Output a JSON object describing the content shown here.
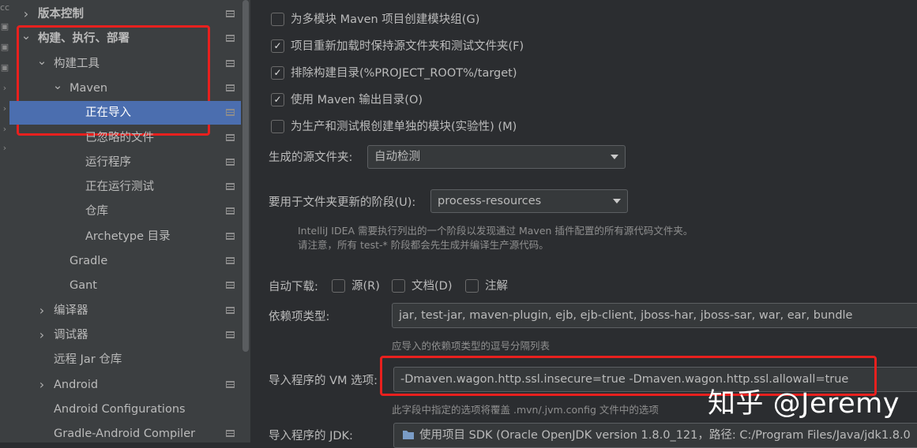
{
  "left_edge": [
    "cc",
    "",
    "",
    "",
    "",
    "",
    "",
    "",
    "",
    "",
    "",
    "",
    "",
    "",
    "",
    "",
    "",
    ""
  ],
  "sidebar": {
    "items": [
      {
        "label": "版本控制",
        "indent": 0,
        "chevron": "right",
        "bold": true
      },
      {
        "label": "构建、执行、部署",
        "indent": 0,
        "chevron": "down",
        "bold": true
      },
      {
        "label": "构建工具",
        "indent": 1,
        "chevron": "down"
      },
      {
        "label": "Maven",
        "indent": 2,
        "chevron": "down"
      },
      {
        "label": "正在导入",
        "indent": 3,
        "chevron": "",
        "selected": true
      },
      {
        "label": "已忽略的文件",
        "indent": 3,
        "chevron": ""
      },
      {
        "label": "运行程序",
        "indent": 3,
        "chevron": ""
      },
      {
        "label": "正在运行测试",
        "indent": 3,
        "chevron": ""
      },
      {
        "label": "仓库",
        "indent": 3,
        "chevron": ""
      },
      {
        "label": "Archetype 目录",
        "indent": 3,
        "chevron": ""
      },
      {
        "label": "Gradle",
        "indent": 2,
        "chevron": ""
      },
      {
        "label": "Gant",
        "indent": 2,
        "chevron": ""
      },
      {
        "label": "编译器",
        "indent": 1,
        "chevron": "right"
      },
      {
        "label": "调试器",
        "indent": 1,
        "chevron": "right"
      },
      {
        "label": "远程 Jar 仓库",
        "indent": 1,
        "chevron": ""
      },
      {
        "label": "Android",
        "indent": 1,
        "chevron": "right"
      },
      {
        "label": "Android Configurations",
        "indent": 1,
        "chevron": ""
      },
      {
        "label": "Gradle-Android Compiler",
        "indent": 1,
        "chevron": ""
      }
    ]
  },
  "main": {
    "checkboxes": [
      {
        "label": "为多模块 Maven 项目创建模块组(G)",
        "checked": false
      },
      {
        "label": "项目重新加载时保持源文件夹和测试文件夹(F)",
        "checked": true
      },
      {
        "label": "排除构建目录(%PROJECT_ROOT%/target)",
        "checked": true
      },
      {
        "label": "使用 Maven 输出目录(O)",
        "checked": true
      },
      {
        "label": "为生产和测试根创建单独的模块(实验性) (M)",
        "checked": false
      }
    ],
    "generated_sources": {
      "label": "生成的源文件夹:",
      "value": "自动检测"
    },
    "phase": {
      "label": "要用于文件夹更新的阶段(U):",
      "value": "process-resources",
      "hint_line1": "IntelliJ IDEA 需要执行列出的一个阶段以发现通过 Maven 插件配置的所有源代码文件夹。",
      "hint_line2": "请注意，所有 test-* 阶段都会先生成并编译生产源代码。"
    },
    "auto_download": {
      "label": "自动下载:",
      "options": [
        {
          "label": "源(R)",
          "checked": false
        },
        {
          "label": "文档(D)",
          "checked": false
        },
        {
          "label": "注解",
          "checked": false
        }
      ]
    },
    "dependency_types": {
      "label": "依赖项类型:",
      "value": "jar, test-jar, maven-plugin, ejb, ejb-client, jboss-har, jboss-sar, war, ear, bundle",
      "hint": "应导入的依赖项类型的逗号分隔列表"
    },
    "vm_options": {
      "label": "导入程序的 VM 选项:",
      "value": "-Dmaven.wagon.http.ssl.insecure=true -Dmaven.wagon.http.ssl.allowall=true",
      "hint": "此字段中指定的选项将覆盖 .mvn/.jvm.config 文件中的选项"
    },
    "jdk": {
      "label": "导入程序的 JDK:",
      "value": "使用项目 SDK (Oracle OpenJDK version 1.8.0_121，路径: C:/Program Files/Java/jdk1.8.0"
    }
  },
  "watermark": "知乎 @Jeremy",
  "colors": {
    "selection": "#4b6eaf",
    "highlight": "#e8201e",
    "background": "#2b2d30",
    "sidebar": "#3c3f41"
  }
}
